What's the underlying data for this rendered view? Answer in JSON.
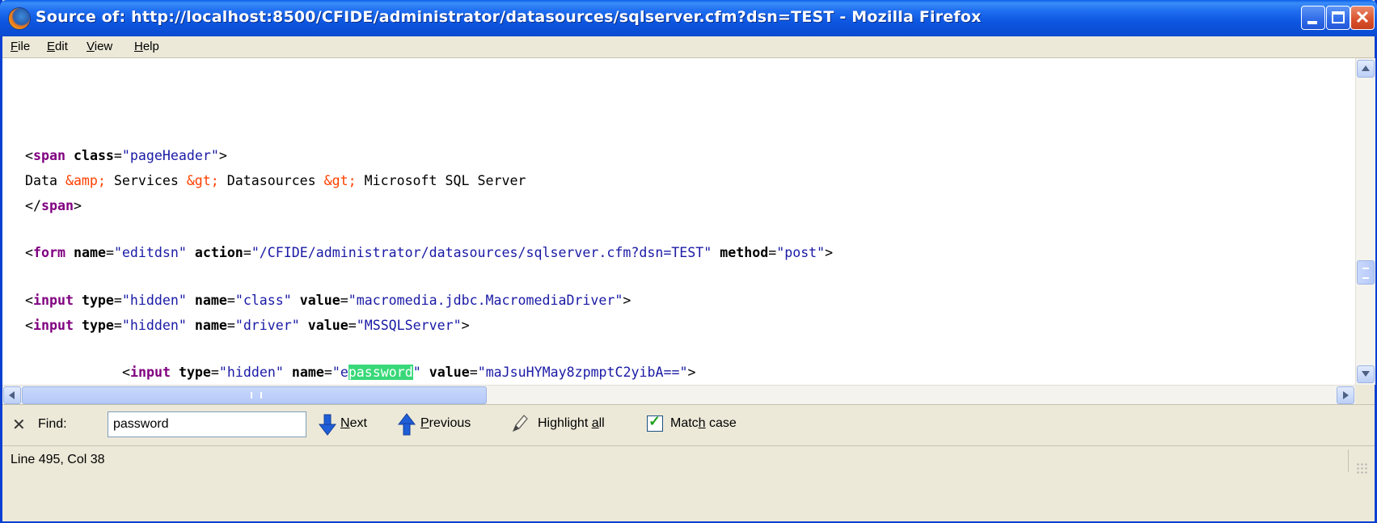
{
  "window": {
    "title": "Source of: http://localhost:8500/CFIDE/administrator/datasources/sqlserver.cfm?dsn=TEST - Mozilla Firefox",
    "icon": "firefox-icon"
  },
  "menu": [
    {
      "label": "File",
      "u": "F",
      "rest": "ile"
    },
    {
      "label": "Edit",
      "u": "E",
      "rest": "dit"
    },
    {
      "label": "View",
      "u": "V",
      "rest": "iew"
    },
    {
      "label": "Help",
      "u": "H",
      "rest": "elp"
    }
  ],
  "source": {
    "l1_tag": "span",
    "l1_attr": "class",
    "l1_val": "\"pageHeader\"",
    "l2_a": "Data ",
    "l2_e1": "&amp;",
    "l2_b": " Services ",
    "l2_e2": "&gt;",
    "l2_c": " Datasources ",
    "l2_e3": "&gt;",
    "l2_d": " Microsoft SQL Server",
    "l3_tag": "span",
    "l4_tag": "form",
    "l4_a1": "name",
    "l4_v1": "\"editdsn\"",
    "l4_a2": "action",
    "l4_v2": "\"/CFIDE/administrator/datasources/sqlserver.cfm?dsn=TEST\"",
    "l4_a3": "method",
    "l4_v3": "\"post\"",
    "l5_tag": "input",
    "l5_a1": "type",
    "l5_v1": "\"hidden\"",
    "l5_a2": "name",
    "l5_v2": "\"class\"",
    "l5_a3": "value",
    "l5_v3": "\"macromedia.jdbc.MacromediaDriver\"",
    "l6_tag": "input",
    "l6_a1": "type",
    "l6_v1": "\"hidden\"",
    "l6_a2": "name",
    "l6_v2": "\"driver\"",
    "l6_a3": "value",
    "l6_v3": "\"MSSQLServer\"",
    "l7_tag": "input",
    "l7_a1": "type",
    "l7_v1": "\"hidden\"",
    "l7_a2": "name",
    "l7_v2_pre": "\"e",
    "l7_v2_hl": "password",
    "l7_v2_post": "\"",
    "l7_a3": "value",
    "l7_v3": "\"maJsuHYMay8zpmptC2yibA==\""
  },
  "find": {
    "label": "Find:",
    "value": "password",
    "next": {
      "u": "N",
      "rest": "ext"
    },
    "previous": {
      "u": "P",
      "rest": "revious"
    },
    "highlight": {
      "pre": "Highlight ",
      "u": "a",
      "rest": "ll"
    },
    "match": {
      "pre": "Matc",
      "u": "h",
      "rest": " case"
    },
    "match_checked": true
  },
  "status": {
    "text": "Line 495, Col 38"
  },
  "colors": {
    "titlebar": "#0a5ee8",
    "tag": "#800080",
    "value": "#1a1aa6",
    "entity": "#ff4000",
    "highlight": "#38d878"
  }
}
